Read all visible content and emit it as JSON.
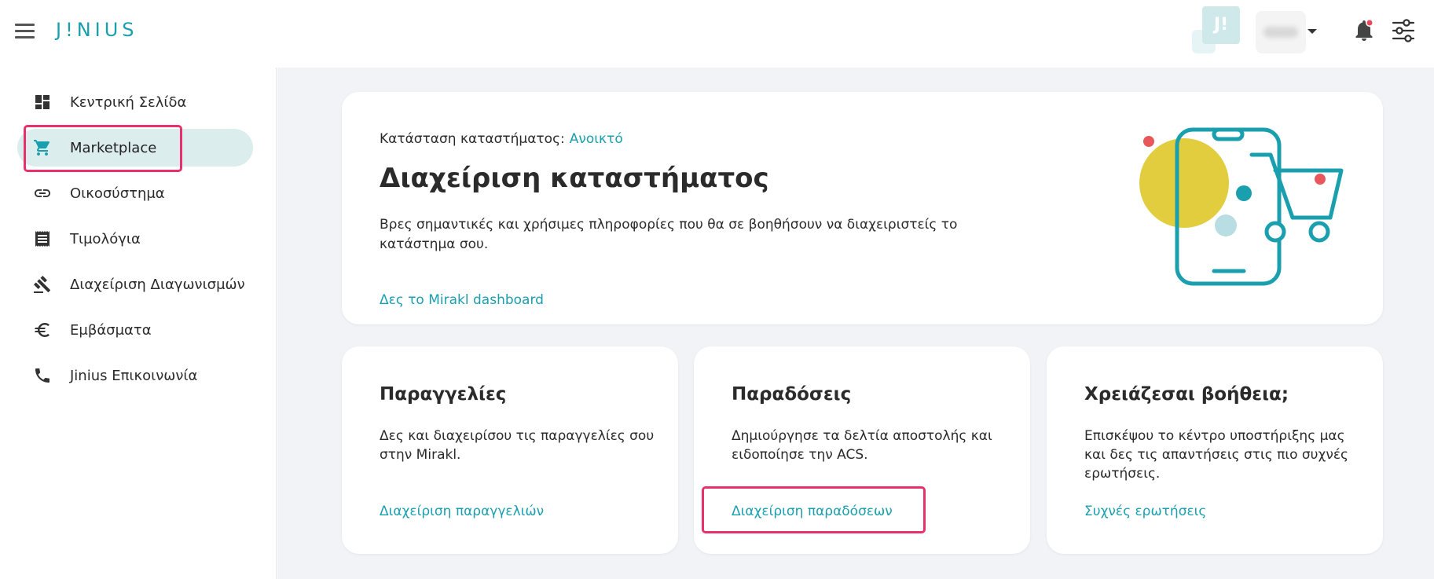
{
  "header": {
    "logo": "J!NIUS",
    "avatar_initials": "J!",
    "icons": [
      "menu-icon",
      "bell-icon",
      "settings-sliders-icon",
      "chevron-down-icon"
    ],
    "brand_color": "#1a9fae",
    "notification_color": "#e8485a"
  },
  "sidebar": {
    "items": [
      {
        "label": "Κεντρική Σελίδα",
        "icon": "dashboard-icon"
      },
      {
        "label": "Marketplace",
        "icon": "cart-icon",
        "active": true
      },
      {
        "label": "Οικοσύστημα",
        "icon": "link-icon"
      },
      {
        "label": "Τιμολόγια",
        "icon": "receipt-icon"
      },
      {
        "label": "Διαχείριση Διαγωνισμών",
        "icon": "gavel-icon"
      },
      {
        "label": "Εμβάσματα",
        "icon": "euro-icon"
      },
      {
        "label": "Jinius Επικοινωνία",
        "icon": "phone-icon"
      }
    ]
  },
  "hero": {
    "status_label": "Κατάσταση καταστήματος:",
    "status_value": "Ανοικτό",
    "title": "Διαχείριση καταστήματος",
    "description": "Βρες σημαντικές και χρήσιμες πληροφορίες που θα σε βοηθήσουν να διαχειριστείς το κατάστημα σου.",
    "link": "Δες το Mirakl dashboard"
  },
  "cards": [
    {
      "title": "Παραγγελίες",
      "description": "Δες και διαχειρίσου τις παραγγελίες σου στην Mirakl.",
      "link": "Διαχείριση παραγγελιών"
    },
    {
      "title": "Παραδόσεις",
      "description": "Δημιούργησε τα δελτία αποστολής και ειδοποίησε την ACS.",
      "link": "Διαχείριση παραδόσεων"
    },
    {
      "title": "Χρειάζεσαι βοήθεια;",
      "description": "Επισκέψου το κέντρο υποστήριξης μας και δες τις απαντήσεις στις πιο συχνές ερωτήσεις.",
      "link": "Συχνές ερωτήσεις"
    }
  ],
  "annotation_color": "#e8306a"
}
